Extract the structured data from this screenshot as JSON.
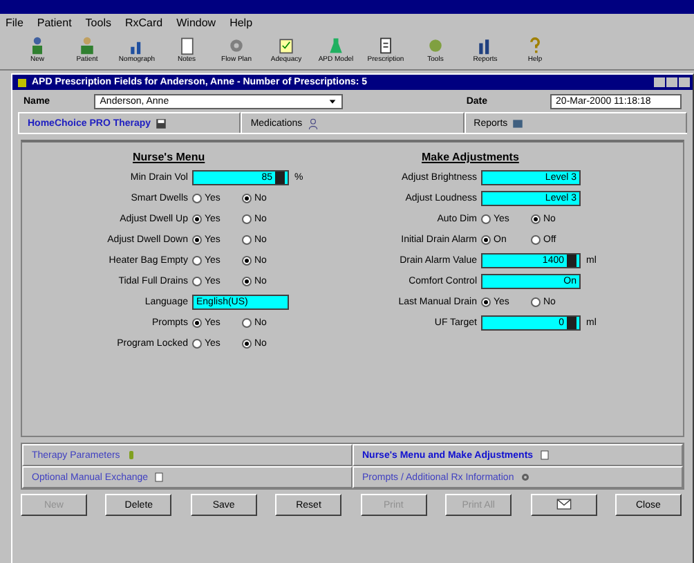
{
  "menu": [
    "File",
    "Patient",
    "Tools",
    "RxCard",
    "Window",
    "Help"
  ],
  "toolbar": [
    {
      "label": "New"
    },
    {
      "label": "Patient"
    },
    {
      "label": "Nomograph"
    },
    {
      "label": "Notes"
    },
    {
      "label": "Flow Plan"
    },
    {
      "label": "Adequacy"
    },
    {
      "label": "APD Model"
    },
    {
      "label": "Prescription"
    },
    {
      "label": "Tools"
    },
    {
      "label": "Reports"
    },
    {
      "label": "Help"
    }
  ],
  "window": {
    "title": "APD Prescription Fields for Anderson, Anne  -  Number of Prescriptions: 5"
  },
  "patient": {
    "name_label": "Name",
    "name": "Anderson, Anne",
    "date_label": "Date",
    "date": "20-Mar-2000 11:18:18"
  },
  "tabs": [
    {
      "label": "HomeChoice PRO Therapy",
      "selected": true
    },
    {
      "label": "Medications",
      "selected": false
    },
    {
      "label": "Reports",
      "selected": false
    }
  ],
  "nurses_menu": {
    "title": "Nurse's Menu",
    "rows": [
      {
        "kind": "spin",
        "label": "Min Drain Vol",
        "value": "85",
        "unit": "%"
      },
      {
        "kind": "radio",
        "label": "Smart Dwells",
        "options": [
          {
            "label": "Yes",
            "selected": false
          },
          {
            "label": "No",
            "selected": true
          }
        ]
      },
      {
        "kind": "radio",
        "label": "Adjust Dwell Up",
        "options": [
          {
            "label": "Yes",
            "selected": true
          },
          {
            "label": "No",
            "selected": false
          }
        ]
      },
      {
        "kind": "radio",
        "label": "Adjust Dwell Down",
        "options": [
          {
            "label": "Yes",
            "selected": true
          },
          {
            "label": "No",
            "selected": false
          }
        ]
      },
      {
        "kind": "radio",
        "label": "Heater Bag Empty",
        "options": [
          {
            "label": "Yes",
            "selected": false
          },
          {
            "label": "No",
            "selected": true
          }
        ]
      },
      {
        "kind": "radio",
        "label": "Tidal Full Drains",
        "options": [
          {
            "label": "Yes",
            "selected": false
          },
          {
            "label": "No",
            "selected": true
          }
        ]
      },
      {
        "kind": "text",
        "label": "Language",
        "value": "English(US)"
      },
      {
        "kind": "radio",
        "label": "Prompts",
        "options": [
          {
            "label": "Yes",
            "selected": true
          },
          {
            "label": "No",
            "selected": false
          }
        ]
      },
      {
        "kind": "radio",
        "label": "Program Locked",
        "options": [
          {
            "label": "Yes",
            "selected": false
          },
          {
            "label": "No",
            "selected": true
          }
        ]
      }
    ]
  },
  "make_adjustments": {
    "title": "Make Adjustments",
    "rows": [
      {
        "kind": "field",
        "label": "Adjust Brightness",
        "value": "Level 3"
      },
      {
        "kind": "field",
        "label": "Adjust Loudness",
        "value": "Level 3"
      },
      {
        "kind": "radio",
        "label": "Auto Dim",
        "options": [
          {
            "label": "Yes",
            "selected": false
          },
          {
            "label": "No",
            "selected": true
          }
        ]
      },
      {
        "kind": "radio",
        "label": "Initial Drain Alarm",
        "options": [
          {
            "label": "On",
            "selected": true
          },
          {
            "label": "Off",
            "selected": false
          }
        ]
      },
      {
        "kind": "spin",
        "label": "Drain Alarm Value",
        "value": "1400",
        "unit": "ml"
      },
      {
        "kind": "field",
        "label": "Comfort Control",
        "value": "On"
      },
      {
        "kind": "radio",
        "label": "Last Manual Drain",
        "options": [
          {
            "label": "Yes",
            "selected": true
          },
          {
            "label": "No",
            "selected": false
          }
        ]
      },
      {
        "kind": "spin",
        "label": "UF Target",
        "value": "0",
        "unit": "ml"
      }
    ]
  },
  "sections": [
    {
      "label": "Therapy Parameters",
      "selected": false
    },
    {
      "label": "Nurse's Menu and Make Adjustments",
      "selected": true
    },
    {
      "label": "Optional Manual Exchange",
      "selected": false
    },
    {
      "label": "Prompts / Additional Rx Information",
      "selected": false
    }
  ],
  "buttons": [
    {
      "kind": "text",
      "label": "New",
      "disabled": true
    },
    {
      "kind": "text",
      "label": "Delete",
      "disabled": false
    },
    {
      "kind": "text",
      "label": "Save",
      "disabled": false
    },
    {
      "kind": "text",
      "label": "Reset",
      "disabled": false
    },
    {
      "kind": "text",
      "label": "Print",
      "disabled": true
    },
    {
      "kind": "text",
      "label": "Print All",
      "disabled": true
    },
    {
      "kind": "mail",
      "disabled": false
    },
    {
      "kind": "text",
      "label": "Close",
      "disabled": false
    }
  ]
}
